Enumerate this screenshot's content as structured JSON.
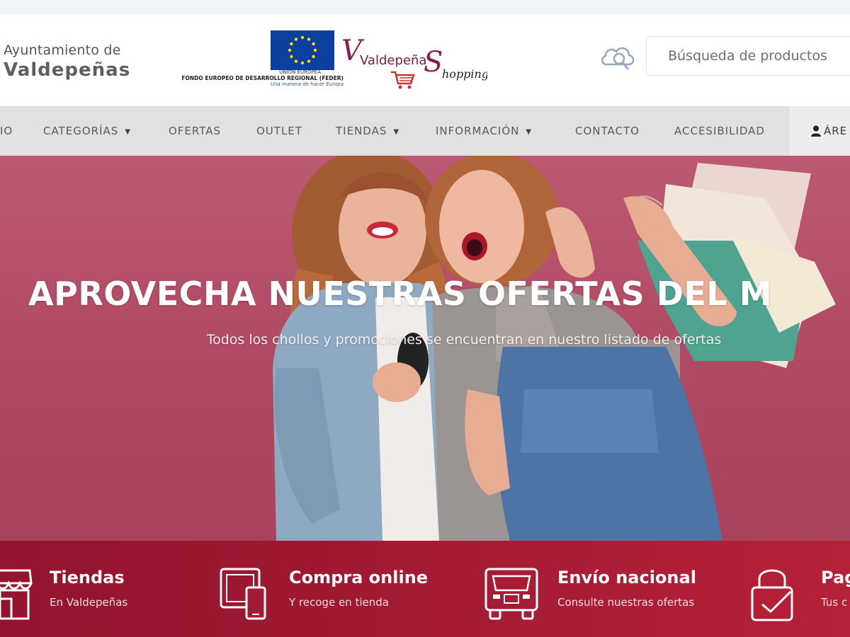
{
  "header": {
    "ayuntamiento_line1": "Ayuntamiento de",
    "ayuntamiento_line2": "Valdepeñas",
    "eu_union": "UNIÓN EUROPEA",
    "eu_fund": "FONDO EUROPEO DE DESARROLLO REGIONAL (FEDER)",
    "eu_slogan": "Una manera de hacer Europa",
    "logo_text_1": "Valdepeña",
    "logo_text_2": "S",
    "logo_text_3": "hopping",
    "search_placeholder": "Búsqueda de productos"
  },
  "nav": {
    "items": [
      {
        "label": "IO"
      },
      {
        "label": "CATEGORÍAS"
      },
      {
        "label": "OFERTAS"
      },
      {
        "label": "OUTLET"
      },
      {
        "label": "TIENDAS"
      },
      {
        "label": "INFORMACIÓN"
      },
      {
        "label": "CONTACTO"
      },
      {
        "label": "ACCESIBILIDAD"
      }
    ],
    "area_label": "ÁRE"
  },
  "hero": {
    "title": "APROVECHA NUESTRAS OFERTAS DEL M",
    "subtitle": "Todos los chollos y promociones se encuentran en nuestro listado de ofertas"
  },
  "features": [
    {
      "title": "Tiendas",
      "desc": "En Valdepeñas",
      "icon": "store-icon"
    },
    {
      "title": "Compra online",
      "desc": "Y recoge en tienda",
      "icon": "devices-icon"
    },
    {
      "title": "Envío nacional",
      "desc": "Consulte nuestras ofertas",
      "icon": "truck-icon"
    },
    {
      "title": "Pag",
      "desc": "Tus c",
      "icon": "secure-payment-icon"
    }
  ],
  "colors": {
    "brand": "#a31a34",
    "hero_bg": "#b14a63",
    "nav_bg": "#e1e1e1",
    "eu_blue": "#0d3f9e",
    "logo_purple": "#8a1d4f"
  }
}
